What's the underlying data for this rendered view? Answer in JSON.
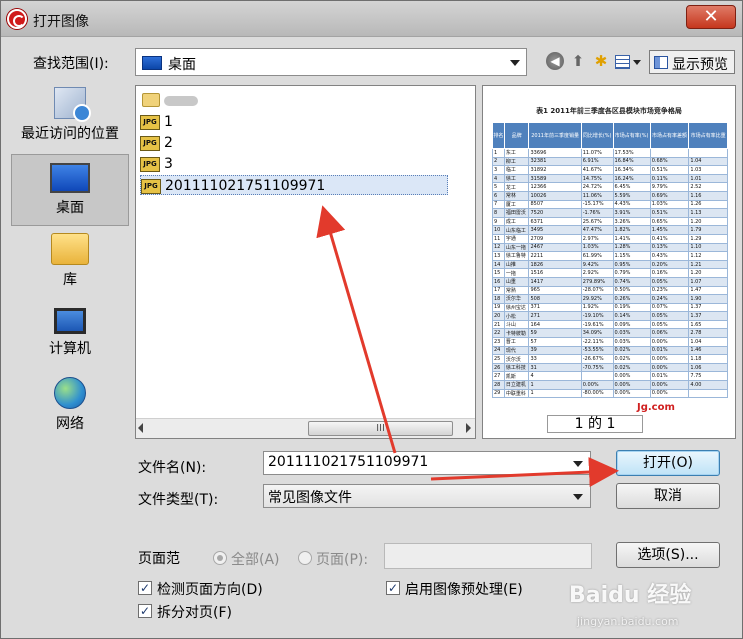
{
  "window": {
    "title": "打开图像",
    "close_symbol": "✕"
  },
  "lookin": {
    "label": "查找范围(I):",
    "value": "桌面"
  },
  "toolbar": {
    "back_symbol": "◀",
    "up_symbol": "⬆",
    "newfolder_symbol": "✱",
    "preview_label": "显示预览"
  },
  "places": [
    {
      "label": "最近访问的位置",
      "icon": "recent-places-icon"
    },
    {
      "label": "桌面",
      "icon": "desktop-icon"
    },
    {
      "label": "库",
      "icon": "library-icon"
    },
    {
      "label": "计算机",
      "icon": "computer-icon"
    },
    {
      "label": "网络",
      "icon": "network-icon"
    }
  ],
  "files": [
    {
      "name": "",
      "type": "folder"
    },
    {
      "name": "1",
      "type": "jpg"
    },
    {
      "name": "2",
      "type": "jpg"
    },
    {
      "name": "3",
      "type": "jpg"
    },
    {
      "name": "201111021751109971",
      "type": "jpg",
      "selected": true
    }
  ],
  "jpg_badge": "JPG",
  "scroll_thumb": "III",
  "preview": {
    "doc_title": "表1  2011年前三季度各区县模块市场竞争格局",
    "table_headers": [
      "排名",
      "品牌",
      "2011年前三季度销量",
      "同比增长(%)",
      "市场占有率(%)",
      "市场占有率差额",
      "市场占有率比重"
    ],
    "rows": [
      [
        "1",
        "东工",
        "33696",
        "11.07%",
        "17.53%",
        "",
        ""
      ],
      [
        "2",
        "柳工",
        "32381",
        "6.91%",
        "16.84%",
        "0.68%",
        "1.04"
      ],
      [
        "3",
        "临工",
        "31892",
        "41.67%",
        "16.34%",
        "0.51%",
        "1.03"
      ],
      [
        "4",
        "徐工",
        "31589",
        "14.75%",
        "16.24%",
        "0.11%",
        "1.01"
      ],
      [
        "5",
        "龙工",
        "12366",
        "24.72%",
        "6.45%",
        "9.79%",
        "2.52"
      ],
      [
        "6",
        "常林",
        "10026",
        "11.06%",
        "5.59%",
        "0.69%",
        "1.16"
      ],
      [
        "7",
        "厦工",
        "8507",
        "-15.17%",
        "4.43%",
        "1.03%",
        "1.26"
      ],
      [
        "8",
        "福田雷沃",
        "7520",
        "-1.76%",
        "3.91%",
        "0.51%",
        "1.13"
      ],
      [
        "9",
        "成工",
        "6371",
        "25.67%",
        "3.26%",
        "0.65%",
        "1.20"
      ],
      [
        "10",
        "山东临工",
        "3495",
        "47.47%",
        "1.82%",
        "1.45%",
        "1.79"
      ],
      [
        "11",
        "宇通",
        "2709",
        "2.97%",
        "1.41%",
        "0.41%",
        "1.29"
      ],
      [
        "12",
        "山东一拖",
        "2467",
        "1.03%",
        "1.28%",
        "0.13%",
        "1.10"
      ],
      [
        "13",
        "徐工鲁特",
        "2211",
        "61.99%",
        "1.15%",
        "0.43%",
        "1.12"
      ],
      [
        "14",
        "山推",
        "1826",
        "9.42%",
        "0.95%",
        "0.20%",
        "1.21"
      ],
      [
        "15",
        "一拖",
        "1516",
        "2.92%",
        "0.79%",
        "0.16%",
        "1.20"
      ],
      [
        "16",
        "山重",
        "1417",
        "279.89%",
        "0.74%",
        "0.05%",
        "1.07"
      ],
      [
        "17",
        "常熟",
        "965",
        "-28.07%",
        "0.50%",
        "0.23%",
        "1.47"
      ],
      [
        "18",
        "沃尔华",
        "508",
        "29.92%",
        "0.26%",
        "0.24%",
        "1.90"
      ],
      [
        "19",
        "徐州宝达",
        "371",
        "1.92%",
        "0.19%",
        "0.07%",
        "1.37"
      ],
      [
        "20",
        "小松",
        "271",
        "-19.10%",
        "0.14%",
        "0.05%",
        "1.37"
      ],
      [
        "21",
        "斗山",
        "164",
        "-19.61%",
        "0.09%",
        "0.05%",
        "1.65"
      ],
      [
        "22",
        "卡特彼勒",
        "59",
        "34.09%",
        "0.03%",
        "0.06%",
        "2.78"
      ],
      [
        "23",
        "晋工",
        "57",
        "-22.11%",
        "0.03%",
        "0.00%",
        "1.04"
      ],
      [
        "24",
        "现代",
        "39",
        "-53.55%",
        "0.02%",
        "0.01%",
        "1.46"
      ],
      [
        "25",
        "沃尔沃",
        "33",
        "-26.67%",
        "0.02%",
        "0.00%",
        "1.18"
      ],
      [
        "26",
        "徐工科技",
        "31",
        "-70.75%",
        "0.02%",
        "0.00%",
        "1.06"
      ],
      [
        "27",
        "凯斯",
        "4",
        "",
        "0.00%",
        "0.01%",
        "7.75"
      ],
      [
        "28",
        "日立建机",
        "1",
        "0.00%",
        "0.00%",
        "0.00%",
        "4.00"
      ],
      [
        "29",
        "中联重科",
        "1",
        "-80.00%",
        "0.00%",
        "0.00%",
        ""
      ]
    ],
    "page_indicator": "1 的 1",
    "mark": "Jg.com"
  },
  "filename": {
    "label": "文件名(N):",
    "value": "201111021751109971"
  },
  "filetype": {
    "label": "文件类型(T):",
    "value": "常见图像文件"
  },
  "buttons": {
    "open": "打开(O)",
    "cancel": "取消",
    "options": "选项(S)..."
  },
  "page_range": {
    "label": "页面范",
    "all": "全部(A)",
    "pages": "页面(P):"
  },
  "checkboxes": {
    "detect_orientation": "检测页面方向(D)",
    "preprocess": "启用图像预处理(E)",
    "split_pages": "拆分对页(F)"
  },
  "watermark": {
    "brand": "Baidu 经验",
    "url": "jingyan.baidu.com"
  },
  "colors": {
    "annotation_arrow": "#e23a2c",
    "default_button_border": "#3c7fb1"
  }
}
